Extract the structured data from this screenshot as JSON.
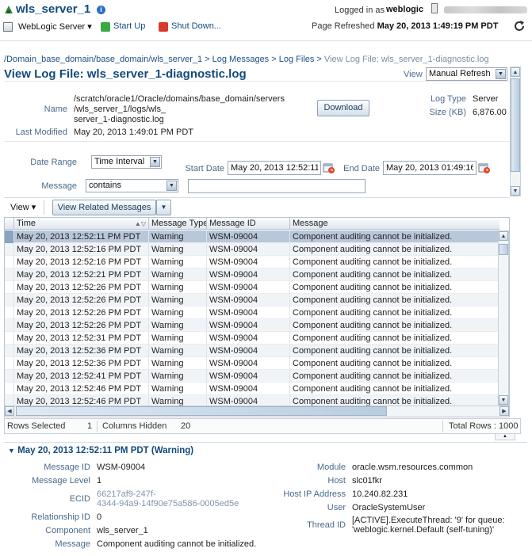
{
  "header": {
    "server_name": "wls_server_1",
    "logged_in_label": "Logged in as",
    "user": "weblogic",
    "menu_label": "WebLogic Server",
    "start_up": "Start Up",
    "shut_down": "Shut Down...",
    "page_refreshed_label": "Page Refreshed",
    "page_refreshed_time": "May 20, 2013 1:49:19 PM PDT"
  },
  "breadcrumb": {
    "items": [
      "/Domain_base_domain/base_domain/wls_server_1",
      "Log Messages",
      "Log Files"
    ],
    "current": "View Log File: wls_server_1-diagnostic.log",
    "separator": " > "
  },
  "page": {
    "title": "View Log File: wls_server_1-diagnostic.log",
    "view_label": "View",
    "view_value": "Manual Refresh"
  },
  "file_info": {
    "name_label": "Name",
    "name_lines": [
      "/scratch/oracle1/Oracle/domains/base_domain/servers",
      "/wls_server_1/logs/wls_",
      "server_1-diagnostic.log"
    ],
    "last_modified_label": "Last Modified",
    "last_modified": "May 20, 2013 1:49:01 PM PDT",
    "download_label": "Download",
    "log_type_label": "Log Type",
    "log_type": "Server",
    "size_label": "Size (KB)",
    "size": "6,876.00"
  },
  "filters": {
    "date_range_label": "Date Range",
    "date_range_value": "Time Interval",
    "start_date_label": "Start Date",
    "start_date": "May 20, 2013 12:52:11",
    "end_date_label": "End Date",
    "end_date": "May 20, 2013 01:49:16",
    "message_label": "Message",
    "message_op": "contains",
    "message_text": ""
  },
  "table": {
    "view_menu": "View",
    "related_button": "View Related Messages",
    "columns": [
      "Time",
      "Message Type",
      "Message ID",
      "Message"
    ],
    "rows": [
      [
        "May 20, 2013 12:52:11 PM PDT",
        "Warning",
        "WSM-09004",
        "Component auditing cannot be initialized."
      ],
      [
        "May 20, 2013 12:52:16 PM PDT",
        "Warning",
        "WSM-09004",
        "Component auditing cannot be initialized."
      ],
      [
        "May 20, 2013 12:52:16 PM PDT",
        "Warning",
        "WSM-09004",
        "Component auditing cannot be initialized."
      ],
      [
        "May 20, 2013 12:52:21 PM PDT",
        "Warning",
        "WSM-09004",
        "Component auditing cannot be initialized."
      ],
      [
        "May 20, 2013 12:52:26 PM PDT",
        "Warning",
        "WSM-09004",
        "Component auditing cannot be initialized."
      ],
      [
        "May 20, 2013 12:52:26 PM PDT",
        "Warning",
        "WSM-09004",
        "Component auditing cannot be initialized."
      ],
      [
        "May 20, 2013 12:52:26 PM PDT",
        "Warning",
        "WSM-09004",
        "Component auditing cannot be initialized."
      ],
      [
        "May 20, 2013 12:52:26 PM PDT",
        "Warning",
        "WSM-09004",
        "Component auditing cannot be initialized."
      ],
      [
        "May 20, 2013 12:52:31 PM PDT",
        "Warning",
        "WSM-09004",
        "Component auditing cannot be initialized."
      ],
      [
        "May 20, 2013 12:52:36 PM PDT",
        "Warning",
        "WSM-09004",
        "Component auditing cannot be initialized."
      ],
      [
        "May 20, 2013 12:52:36 PM PDT",
        "Warning",
        "WSM-09004",
        "Component auditing cannot be initialized."
      ],
      [
        "May 20, 2013 12:52:41 PM PDT",
        "Warning",
        "WSM-09004",
        "Component auditing cannot be initialized."
      ],
      [
        "May 20, 2013 12:52:46 PM PDT",
        "Warning",
        "WSM-09004",
        "Component auditing cannot be initialized."
      ],
      [
        "May 20, 2013 12:52:46 PM PDT",
        "Warning",
        "WSM-09004",
        "Component auditing cannot be initialized."
      ]
    ],
    "selected_index": 0,
    "rows_selected_label": "Rows Selected",
    "rows_selected": "1",
    "columns_hidden_label": "Columns Hidden",
    "columns_hidden": "20",
    "total_rows_label": "Total Rows :",
    "total_rows": "1000"
  },
  "detail": {
    "title": "May 20, 2013 12:52:11 PM PDT (Warning)",
    "left": [
      {
        "label": "Message ID",
        "value": "WSM-09004"
      },
      {
        "label": "Message Level",
        "value": "1"
      },
      {
        "label": "ECID",
        "value": "66217af9-247f-\n4344-94a9-14f90e75a586-0005ed5e"
      },
      {
        "label": "Relationship ID",
        "value": "0"
      },
      {
        "label": "Component",
        "value": "wls_server_1"
      },
      {
        "label": "Message",
        "value": "Component auditing cannot be initialized."
      }
    ],
    "right": [
      {
        "label": "Module",
        "value": "oracle.wsm.resources.common"
      },
      {
        "label": "Host",
        "value": "slc01fkr"
      },
      {
        "label": "Host IP Address",
        "value": "10.240.82.231"
      },
      {
        "label": "User",
        "value": "OracleSystemUser"
      },
      {
        "label": "Thread ID",
        "value": "[ACTIVE].ExecuteThread: '9' for queue:\n'weblogic.kernel.Default (self-tuning)'"
      }
    ]
  }
}
